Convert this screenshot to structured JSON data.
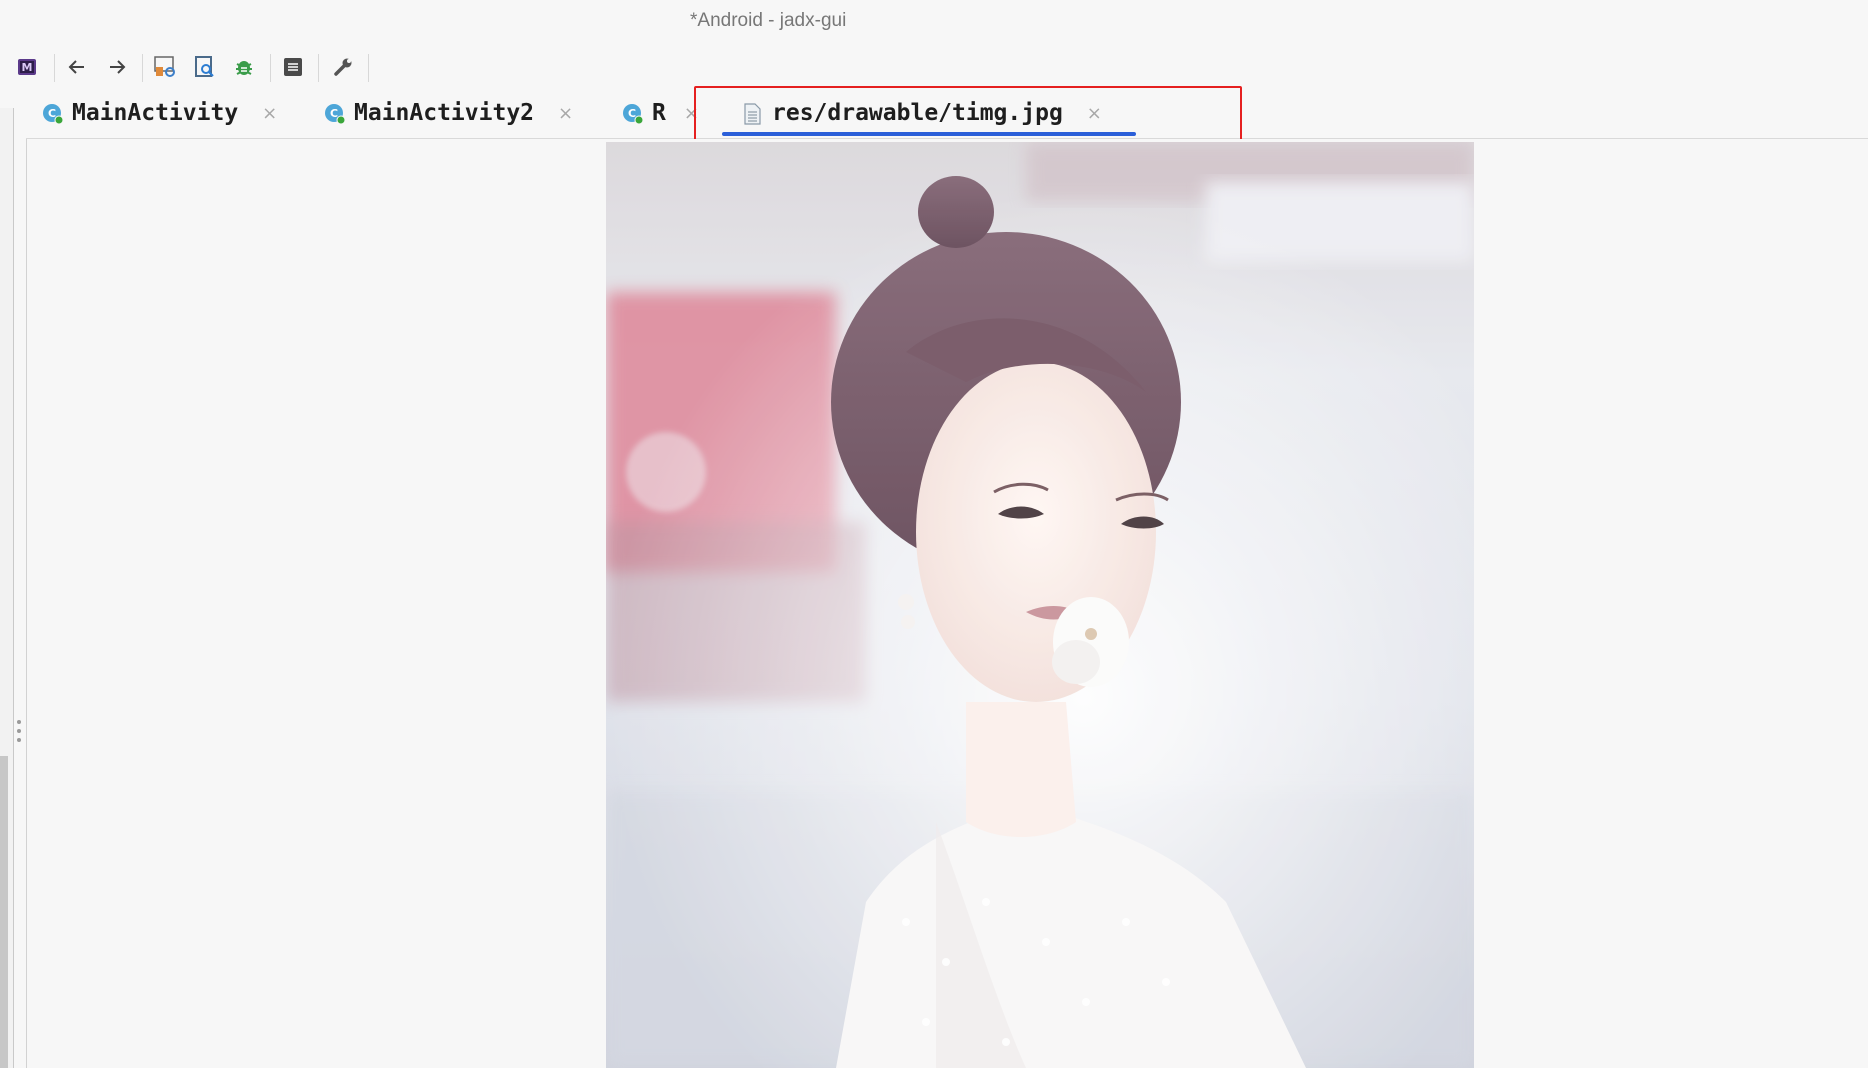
{
  "window": {
    "title": "*Android - jadx-gui"
  },
  "toolbar": {
    "buttons": [
      {
        "name": "sync-tree-icon"
      },
      {
        "name": "back-icon"
      },
      {
        "name": "forward-icon"
      },
      {
        "name": "deobfuscation-icon"
      },
      {
        "name": "find-icon"
      },
      {
        "name": "debug-icon"
      },
      {
        "name": "log-viewer-icon"
      },
      {
        "name": "preferences-icon"
      }
    ]
  },
  "tabs": [
    {
      "label": "MainActivity",
      "type": "class",
      "close": "×"
    },
    {
      "label": "MainActivity2",
      "type": "class",
      "close": "×"
    },
    {
      "label": "R",
      "type": "class",
      "close": "×"
    },
    {
      "label": "res/drawable/timg.jpg",
      "type": "image-file",
      "close": "×",
      "active": true
    }
  ],
  "colors": {
    "active_tab_underline": "#2b5fd9",
    "highlight_box": "#e52020",
    "class_icon": "#4da6d8",
    "class_icon_dot": "#3aa63a"
  }
}
